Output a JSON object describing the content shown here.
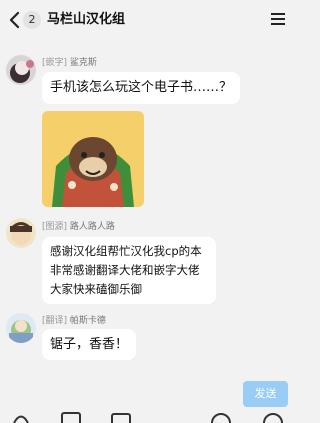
{
  "header": {
    "unread_count": "2",
    "title": "马栏山汉化组"
  },
  "messages": [
    {
      "role_tag": "[嵌字]",
      "name": "鲨克斯",
      "text": "手机该怎么玩这个电子书……？"
    },
    {
      "role_tag": "[图源]",
      "name": "路人路人路",
      "lines": [
        "感谢汉化组帮忙汉化我cp的本",
        "非常感谢翻译大佬和嵌字大佬",
        "大家快来磕御乐御"
      ]
    },
    {
      "role_tag": "[翻译]",
      "name": "帕斯卡德",
      "text": "锯子，香香！"
    }
  ],
  "composer": {
    "send_label": "发送"
  },
  "colors": {
    "accent": "#99cdf5",
    "background": "#f2f2f2",
    "bubble": "#ffffff"
  },
  "icons": [
    "back-icon",
    "menu-icon",
    "sticker-image",
    "avatar"
  ]
}
